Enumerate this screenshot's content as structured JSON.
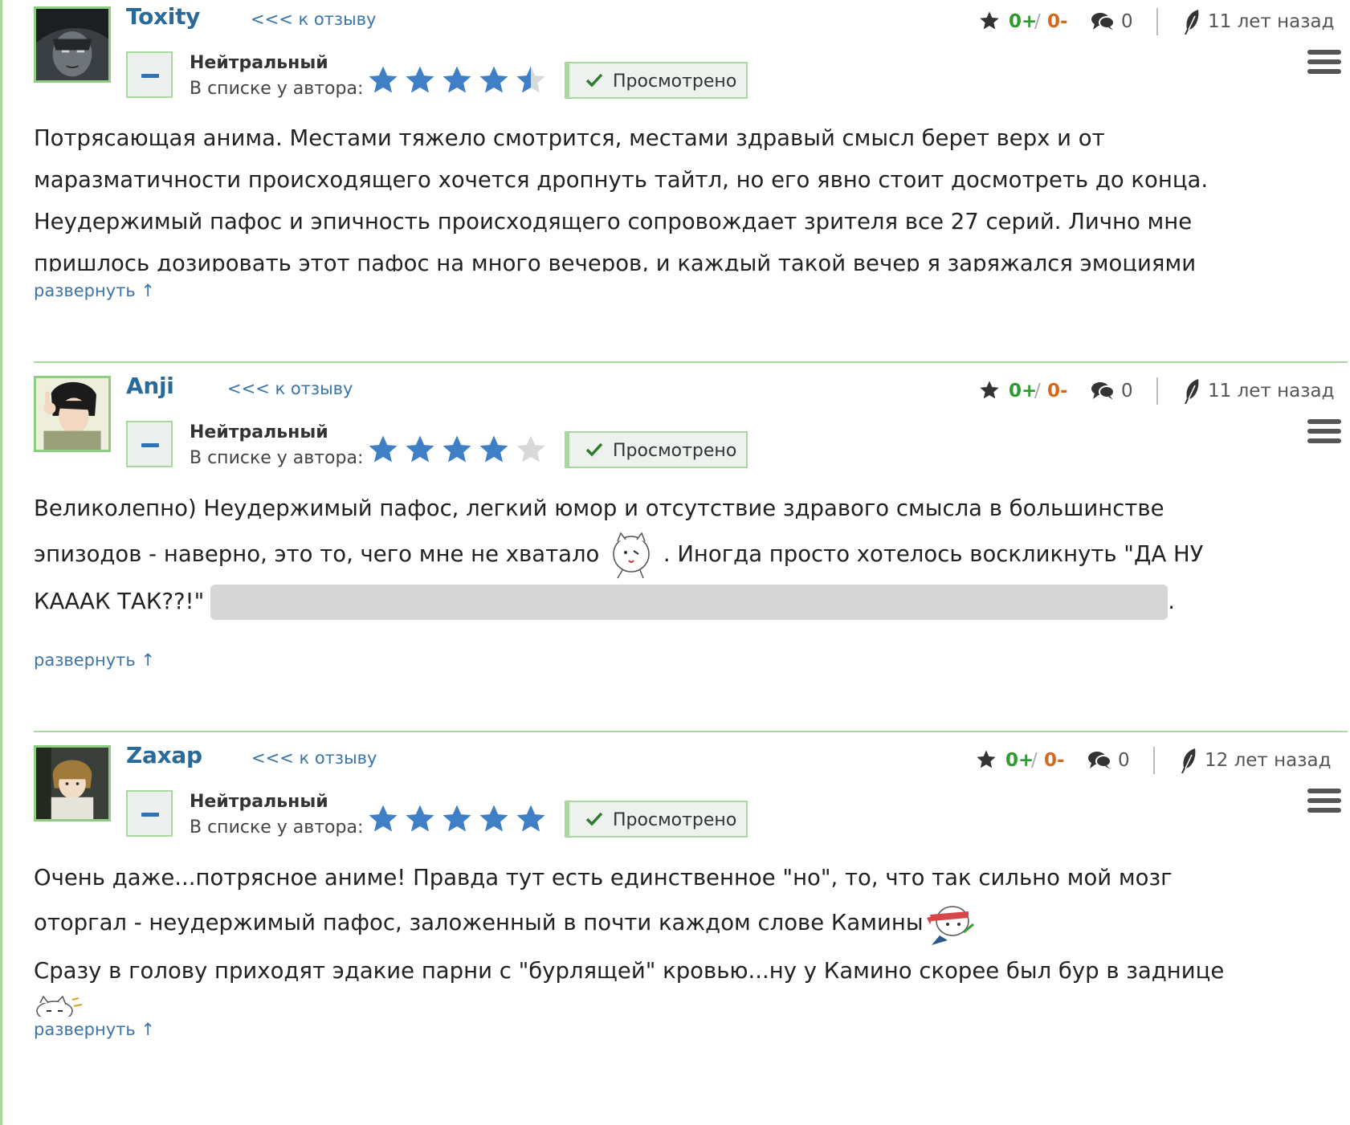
{
  "common": {
    "to_review": "<<< к отзыву",
    "neutral": "Нейтральный",
    "in_list": "В списке у автора:",
    "seen": "Просмотрено",
    "plus": "0+",
    "slash": "/",
    "minus": "0-",
    "comments": "0",
    "expand": "развернуть ↑"
  },
  "reviews": [
    {
      "user": "Toxity",
      "date": "11 лет назад",
      "rating_stars": 4.5,
      "lines": [
        "Потрясающая анима. Местами тяжело смотрится, местами здравый смысл берет верх и от",
        "маразматичности происходящего хочется дропнуть тайтл, но его явно стоит досмотреть до конца.",
        "Неудержимый пафос и эпичность происходящего сопровождает зрителя все 27 серий. Лично мне",
        "пришлось дозировать этот пафос на много вечеров, и каждый такой вечер я заряжался эмоциями"
      ]
    },
    {
      "user": "Anji",
      "date": "11 лет назад",
      "rating_stars": 4,
      "lines": [
        "Великолепно) Неудержимый пафос, легкий юмор и отсутствие здравого смысла в большинстве",
        "эпизодов - наверно, это то, чего мне не хватало",
        ". Иногда просто хотелось воскликнуть \"ДА НУ",
        "КАААК ТАК??!\"",
        "."
      ]
    },
    {
      "user": "Zaxap",
      "date": "12 лет назад",
      "rating_stars": 5,
      "lines": [
        "Очень даже...потрясное аниме! Правда тут есть единственное \"но\", то, что так сильно мой мозг",
        "оторгал - неудержимый пафос, заложенный в почти каждом слове Камины",
        "Сразу в голову приходят эдакие парни с \"бурлящей\" кровью...ну у Камино скорее был бур в заднице"
      ]
    }
  ],
  "colors": {
    "accent_green": "#a9d7a0",
    "link_blue": "#3b74a8",
    "star_blue": "#3f7fc6",
    "plus_green": "#2e9a2e",
    "minus_orange": "#d4691c"
  }
}
